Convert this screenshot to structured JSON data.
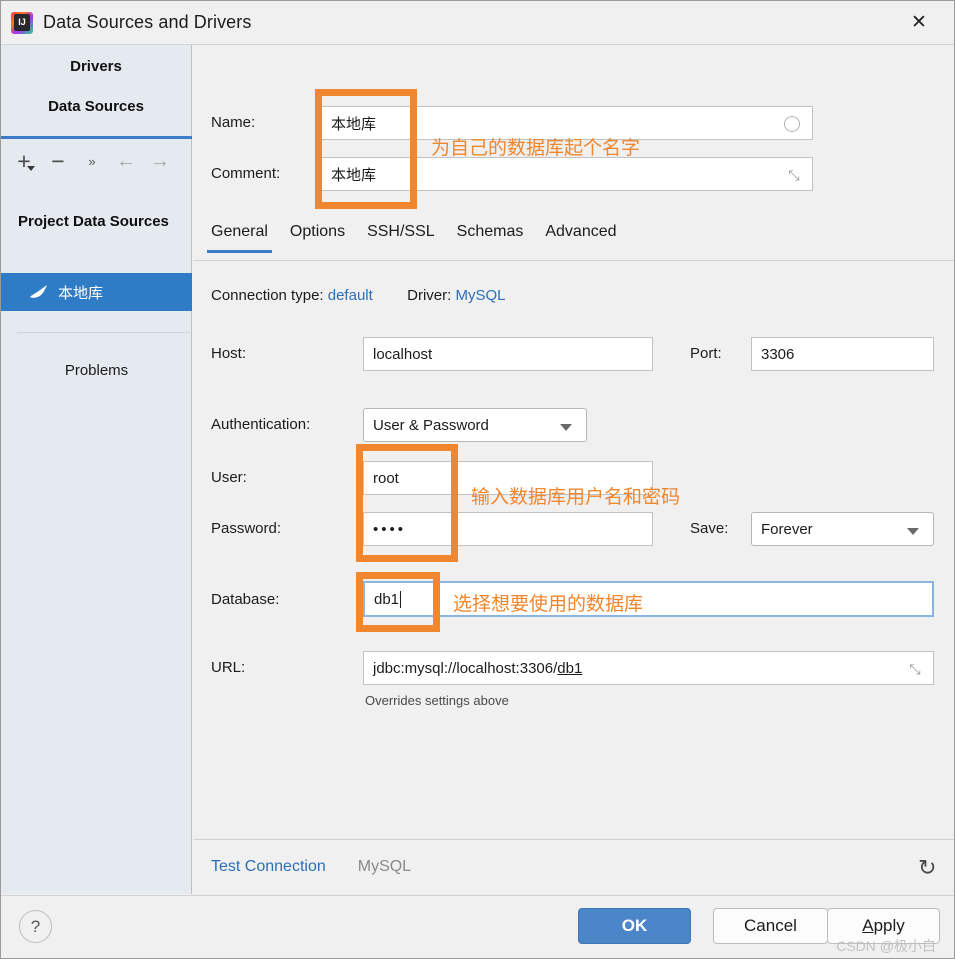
{
  "window": {
    "title": "Data Sources and Drivers",
    "app_icon": "intellij-idea-icon",
    "close_label": "✕"
  },
  "sidebar": {
    "drivers_label": "Drivers",
    "data_sources_label": "Data Sources",
    "toolbar": [
      {
        "name": "add-button",
        "glyph": "+"
      },
      {
        "name": "remove-button",
        "glyph": "−"
      },
      {
        "name": "more-button",
        "glyph": "»"
      },
      {
        "name": "back-button",
        "glyph": "←"
      },
      {
        "name": "forward-button",
        "glyph": "→"
      }
    ],
    "project_data_sources_label": "Project Data Sources",
    "data_source_item": {
      "label": "本地库",
      "icon": "mysql-dolphin-icon"
    },
    "problems_label": "Problems"
  },
  "form": {
    "name_label": "Name:",
    "name_value": "本地库",
    "comment_label": "Comment:",
    "comment_value": "本地库",
    "expand_icon": "⤡"
  },
  "tabs": [
    {
      "label": "General",
      "active": true
    },
    {
      "label": "Options",
      "active": false
    },
    {
      "label": "SSH/SSL",
      "active": false
    },
    {
      "label": "Schemas",
      "active": false
    },
    {
      "label": "Advanced",
      "active": false
    }
  ],
  "general": {
    "connection_type_label": "Connection type:",
    "connection_type_value": "default",
    "driver_label": "Driver:",
    "driver_value": "MySQL",
    "host_label": "Host:",
    "host_value": "localhost",
    "port_label": "Port:",
    "port_value": "3306",
    "authentication_label": "Authentication:",
    "authentication_value": "User & Password",
    "user_label": "User:",
    "user_value": "root",
    "password_label": "Password:",
    "password_value": "••••",
    "save_label": "Save:",
    "save_value": "Forever",
    "database_label": "Database:",
    "database_value": "db1",
    "url_label": "URL:",
    "url_prefix": "jdbc:mysql://localhost:3306/",
    "url_db": "db1",
    "url_hint": "Overrides settings above"
  },
  "annotations": {
    "color": "#f0862d",
    "name_note": "为自己的数据库起个名字",
    "user_note": "输入数据库用户名和密码",
    "database_note": "选择想要使用的数据库"
  },
  "bottom": {
    "test_connection_label": "Test Connection",
    "driver_label": "MySQL",
    "revert_icon": "↺"
  },
  "footer": {
    "help_label": "?",
    "ok_label": "OK",
    "cancel_label": "Cancel",
    "apply_mnemonic": "A",
    "apply_rest": "pply",
    "watermark": "CSDN @极小白"
  },
  "colors": {
    "accent_blue": "#3d7cc9",
    "selection_blue": "#2f7cc6",
    "link_blue": "#2a6fba",
    "annotation_orange": "#f0862d",
    "sidebar_bg": "#e4eaf0",
    "panel_bg": "#f0f0f0"
  }
}
